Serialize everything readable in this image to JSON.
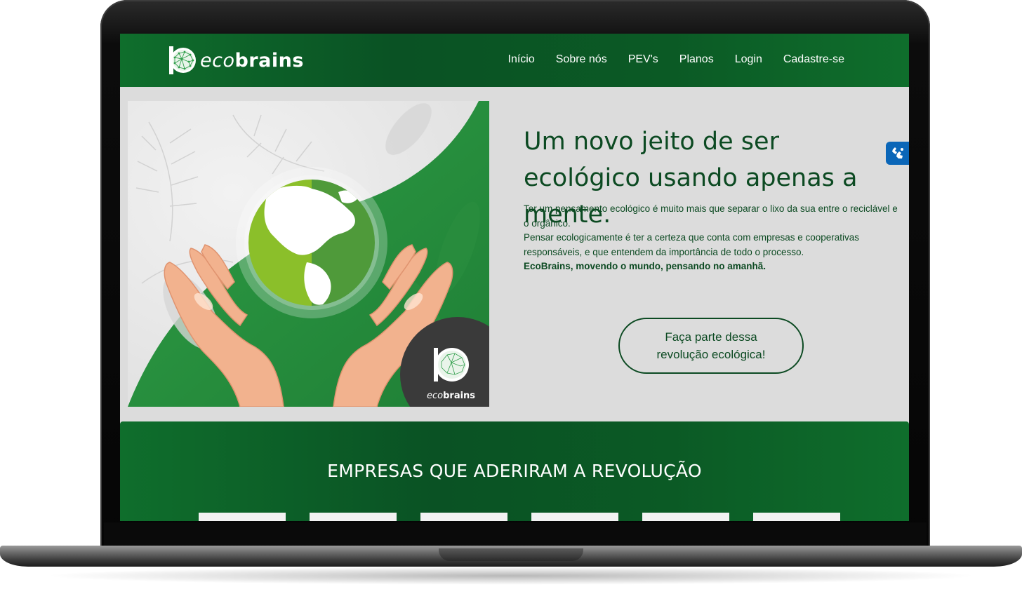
{
  "brand": {
    "logo_light": "eco",
    "logo_bold": "brains",
    "colors": {
      "primary": "#0a5224",
      "text_dark": "#0c4a22",
      "accent_blue": "#0a66b8",
      "page_bg": "#dcdcdc"
    }
  },
  "nav": {
    "items": [
      {
        "label": "Início"
      },
      {
        "label": "Sobre nós"
      },
      {
        "label": "PEV's"
      },
      {
        "label": "Planos"
      },
      {
        "label": "Login"
      },
      {
        "label": "Cadastre-se"
      }
    ]
  },
  "hero": {
    "heading": "Um novo jeito de ser ecológico usando apenas a mente.",
    "paragraph_1": "Ter um pensamento ecológico é muito mais que separar o lixo da sua entre o reciclável e o orgânico.",
    "paragraph_2": "Pensar ecologicamente é ter a certeza que conta com empresas e cooperativas responsáveis, e que entendem da importância de todo o processo.",
    "tagline": "EcoBrains, movendo o mundo, pensando no amanhã.",
    "cta_label": "Faça parte dessa revolução ecológica!",
    "image_badge_light": "eco",
    "image_badge_bold": "brains"
  },
  "accessibility": {
    "icon": "sign-language-hands-icon"
  },
  "companies": {
    "title": "EMPRESAS QUE ADERIRAM A REVOLUÇÃO",
    "card_count": 6
  }
}
